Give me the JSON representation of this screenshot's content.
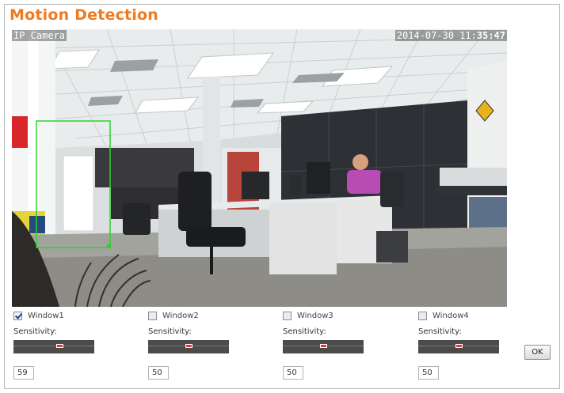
{
  "page": {
    "title": "Motion Detection"
  },
  "video": {
    "osd_left": "IP Camera",
    "osd_date": "2014-07-30 11:",
    "osd_seconds": "35:47"
  },
  "zones": [
    {
      "name": "Window1",
      "checked": true,
      "sensitivity_label": "Sensitivity:",
      "value": "59",
      "level": 0.57
    },
    {
      "name": "Window2",
      "checked": false,
      "sensitivity_label": "Sensitivity:",
      "value": "50",
      "level": 0.5
    },
    {
      "name": "Window3",
      "checked": false,
      "sensitivity_label": "Sensitivity:",
      "value": "50",
      "level": 0.5
    },
    {
      "name": "Window4",
      "checked": false,
      "sensitivity_label": "Sensitivity:",
      "value": "50",
      "level": 0.5
    }
  ],
  "actions": {
    "ok_label": "OK"
  },
  "colors": {
    "title": "#f07a1e",
    "motion_window": "#2fd12f",
    "slider_thumb": "#e43a30"
  }
}
